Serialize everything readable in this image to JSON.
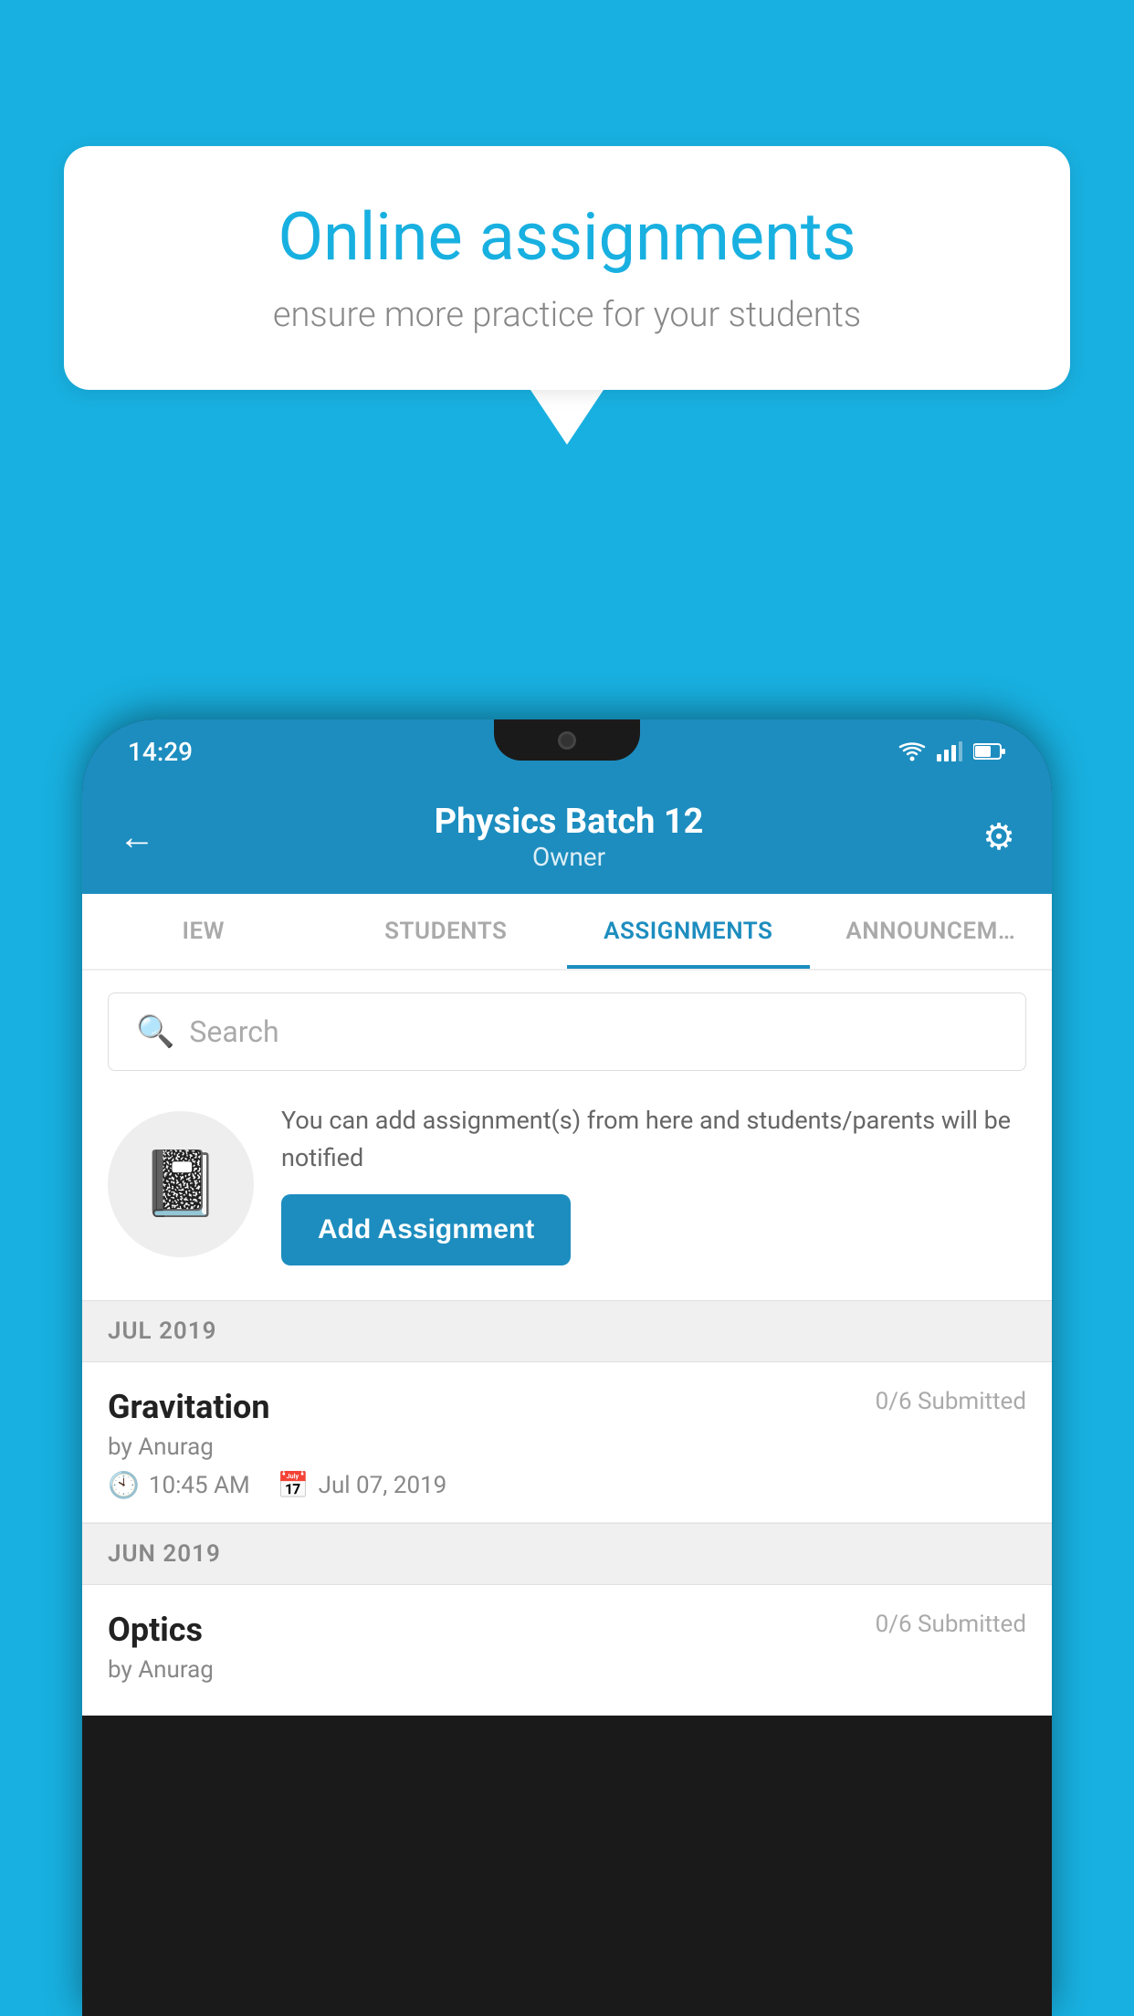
{
  "background_color": "#18b0e0",
  "speech_bubble": {
    "title": "Online assignments",
    "subtitle": "ensure more practice for your students"
  },
  "status_bar": {
    "time": "14:29"
  },
  "app_header": {
    "title": "Physics Batch 12",
    "subtitle": "Owner",
    "back_label": "←",
    "settings_label": "⚙"
  },
  "tabs": [
    {
      "label": "IEW",
      "active": false
    },
    {
      "label": "STUDENTS",
      "active": false
    },
    {
      "label": "ASSIGNMENTS",
      "active": true
    },
    {
      "label": "ANNOUNCEM…",
      "active": false
    }
  ],
  "search": {
    "placeholder": "Search"
  },
  "promo_card": {
    "description": "You can add assignment(s) from here and students/parents will be notified",
    "add_button_label": "Add Assignment"
  },
  "sections": [
    {
      "header": "JUL 2019",
      "assignments": [
        {
          "name": "Gravitation",
          "status": "0/6 Submitted",
          "author": "by Anurag",
          "time": "10:45 AM",
          "date": "Jul 07, 2019"
        }
      ]
    },
    {
      "header": "JUN 2019",
      "assignments": [
        {
          "name": "Optics",
          "status": "0/6 Submitted",
          "author": "by Anurag",
          "time": "",
          "date": ""
        }
      ]
    }
  ]
}
